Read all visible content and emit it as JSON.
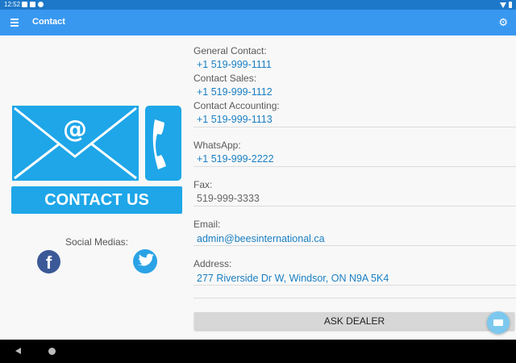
{
  "status_bar": {
    "time": "12:52"
  },
  "toolbar": {
    "title": "Contact",
    "menu_icon": "hamburger-menu-icon",
    "settings_icon": "gear-icon"
  },
  "banner": {
    "text": "CONTACT US"
  },
  "social": {
    "label": "Social Medias:",
    "facebook_glyph": "f"
  },
  "contacts": {
    "general_label": "General Contact:",
    "general_value": "+1 519-999-1111",
    "sales_label": "Contact Sales:",
    "sales_value": "+1 519-999-1112",
    "accounting_label": "Contact Accounting:",
    "accounting_value": "+1 519-999-1113",
    "whatsapp_label": "WhatsApp:",
    "whatsapp_value": "+1 519-999-2222",
    "fax_label": "Fax:",
    "fax_value": "519-999-3333",
    "email_label": "Email:",
    "email_value": "admin@beesinternational.ca",
    "address_label": "Address:",
    "address_value": "277 Riverside Dr W, Windsor, ON N9A 5K4"
  },
  "actions": {
    "ask_dealer": "ASK DEALER"
  },
  "colors": {
    "primary": "#3898f0",
    "status_bar": "#1d78c9",
    "accent": "#1ea6e8",
    "link": "#1a7fc3"
  }
}
